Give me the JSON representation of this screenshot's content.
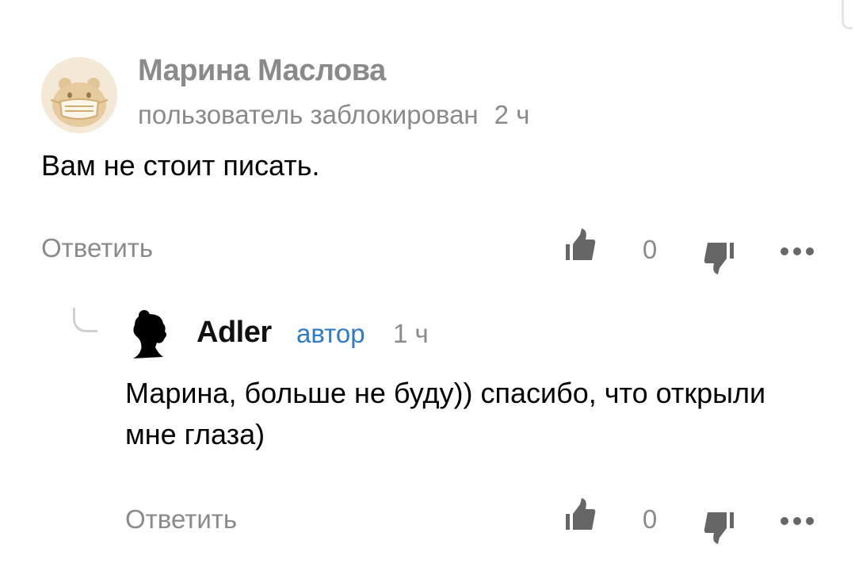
{
  "comments": [
    {
      "author": "Марина Маслова",
      "status": "пользователь заблокирован",
      "time": "2 ч",
      "text": "Вам не стоит писать.",
      "reply_label": "Ответить",
      "likes": "0"
    },
    {
      "author": "Adler",
      "badge": "автор",
      "time": "1 ч",
      "text": "Марина, больше не буду)) спасибо, что открыли мне глаза)",
      "reply_label": "Ответить",
      "likes": "0"
    }
  ],
  "colors": {
    "muted_text": "#8a8a8a",
    "author_badge": "#2f7bc8",
    "icon": "#666666",
    "avatar_bg": "#f4e8d6",
    "avatar_fg": "#d2ad72"
  },
  "icons": {
    "like": "thumbs-up-icon",
    "dislike": "thumbs-down-icon",
    "more": "more-horizontal-icon"
  }
}
